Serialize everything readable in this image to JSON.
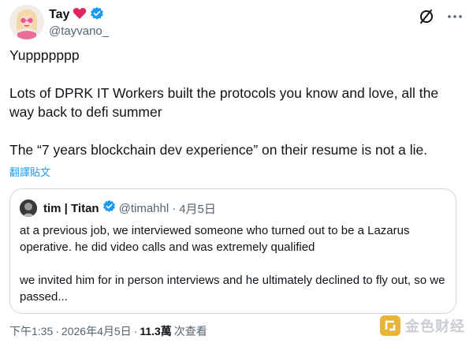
{
  "author": {
    "display_name": "Tay",
    "emoji": "❤️",
    "handle": "@tayvano_"
  },
  "tweet": {
    "paragraphs": [
      "Yuppppppp",
      "Lots of DPRK IT Workers built the protocols you know and love, all the way back to defi summer",
      "The “7 years blockchain dev experience” on their resume is not a lie."
    ],
    "translate_label": "翻譯貼文"
  },
  "quote": {
    "display_name": "tim | Titan",
    "handle": "@timahhl",
    "separator": "·",
    "date": "4月5日",
    "paragraphs": [
      "at a previous job, we interviewed someone who turned out to be a Lazarus operative. he did video calls and was extremely qualified",
      "we invited him for in person interviews and he ultimately declined to fly out, so we passed..."
    ]
  },
  "footer": {
    "time": "下午1:35",
    "dot1": "·",
    "date": "2026年4月5日",
    "dot2": "·",
    "views_count": "11.3萬",
    "views_label": "次查看"
  },
  "watermark": {
    "text": "金色财经"
  },
  "icons": {
    "verified": "verified-badge-icon",
    "grok": "grok-icon",
    "more": "more-icon"
  },
  "colors": {
    "verified": "#1d9bf0",
    "link": "#1d9bf0",
    "secondary_text": "#536471",
    "border": "#cfd9de"
  }
}
